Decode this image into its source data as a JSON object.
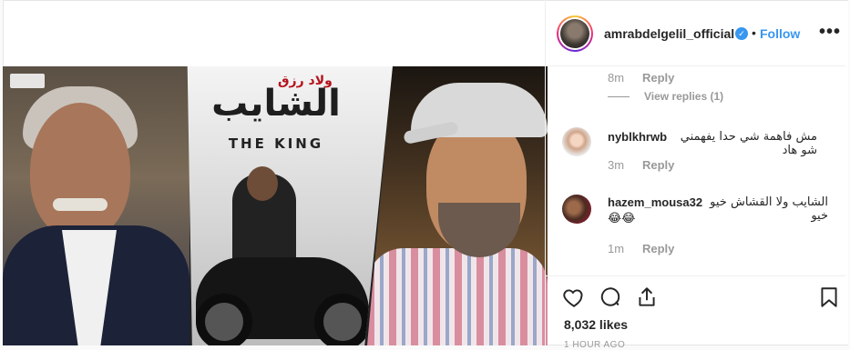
{
  "header": {
    "username": "amrabdelgelil_official",
    "verified_icon": "verified-check-icon",
    "separator": "•",
    "follow_label": "Follow",
    "more_icon": "more-options-icon",
    "follow_color": "#3897f0"
  },
  "media": {
    "center_title": "الشايب",
    "center_subtitle": "ولاد رزق",
    "center_tagline": "THE KING"
  },
  "comments": {
    "top": {
      "time": "8m",
      "reply_label": "Reply",
      "view_replies": "View replies (1)"
    },
    "items": [
      {
        "username": "nyblkhrwb",
        "text": "مش فاهمة شي حدا يفهمني شو هاد",
        "time": "3m",
        "reply_label": "Reply"
      },
      {
        "username": "hazem_mousa32",
        "text": "الشايب ولا القشاش خيو خيو",
        "emoji": "😂😂",
        "time": "1m",
        "reply_label": "Reply"
      }
    ]
  },
  "actions": {
    "like_icon": "heart-icon",
    "comment_icon": "comment-icon",
    "share_icon": "share-icon",
    "save_icon": "bookmark-icon",
    "likes": "8,032 likes",
    "time_ago": "1 HOUR AGO"
  }
}
